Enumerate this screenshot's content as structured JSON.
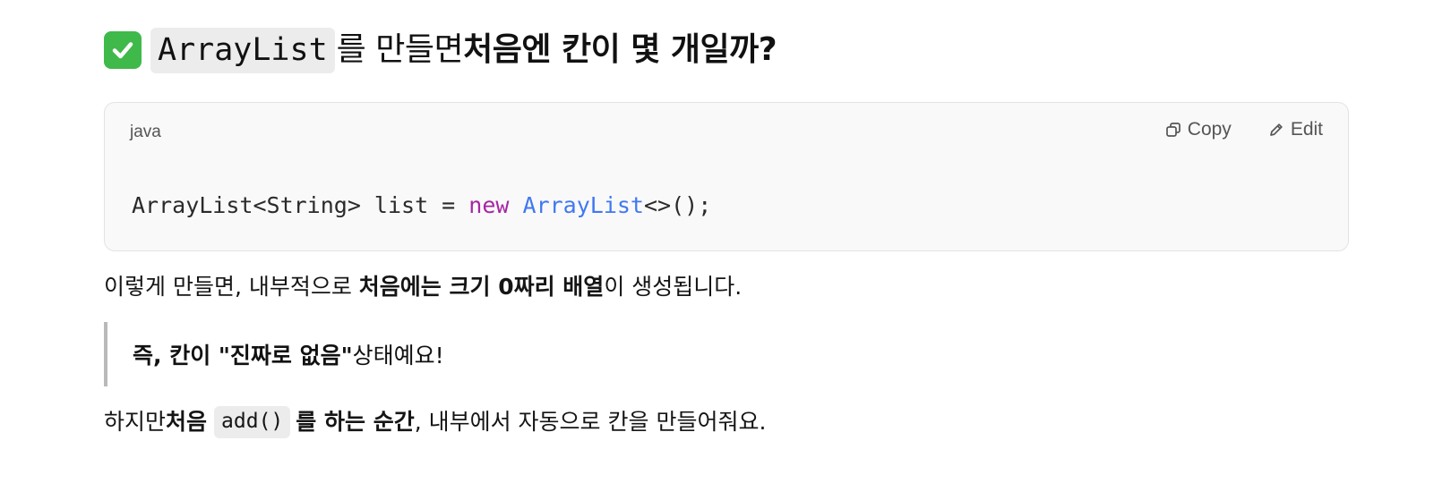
{
  "heading": {
    "code": "ArrayList",
    "text_normal": "를 만들면 ",
    "text_bold": "처음엔 칸이 몇 개일까?",
    "icon": "check-mark-button-icon"
  },
  "code_block": {
    "language": "java",
    "copy_label": "Copy",
    "edit_label": "Edit",
    "code": {
      "part1": "ArrayList<String> list = ",
      "keyword": "new",
      "space": " ",
      "type": "ArrayList",
      "part2": "<>();"
    }
  },
  "paragraph1": {
    "t1": "이렇게 만들면, 내부적으로 ",
    "b1": "처음에는 크기 0짜리 배열",
    "t2": "이 생성됩니다."
  },
  "quote": {
    "b1": "즉, 칸이 \"진짜로 없음\"",
    "t1": " 상태예요!"
  },
  "paragraph2": {
    "t1": "하지만 ",
    "b1": "처음",
    "code": "add()",
    "b2": "를 하는 순간",
    "t2": ", 내부에서 자동으로 칸을 만들어줘요."
  },
  "colors": {
    "keyword": "#a626a4",
    "type": "#4078f2",
    "check": "#3fb94a"
  }
}
